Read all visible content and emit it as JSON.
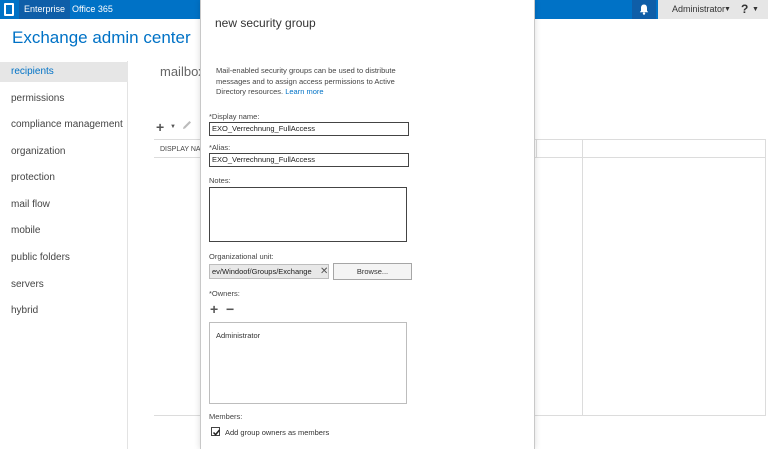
{
  "topbar": {
    "office_icon": "office-logo-icon",
    "tabs": [
      {
        "label": "Enterprise",
        "active": true
      },
      {
        "label": "Office 365",
        "active": false
      }
    ],
    "notification_icon": "bell-icon",
    "user": "Administrator",
    "help": "?",
    "accent": "#0072c6"
  },
  "app_title": "Exchange admin center",
  "leftnav": {
    "items": [
      {
        "label": "recipients",
        "selected": true
      },
      {
        "label": "permissions"
      },
      {
        "label": "compliance management"
      },
      {
        "label": "organization"
      },
      {
        "label": "protection"
      },
      {
        "label": "mail flow"
      },
      {
        "label": "mobile"
      },
      {
        "label": "public folders"
      },
      {
        "label": "servers"
      },
      {
        "label": "hybrid"
      }
    ]
  },
  "main": {
    "title": "mailboxes",
    "toolbar": {
      "add_icon": "plus-icon",
      "edit_icon": "pencil-icon"
    },
    "column_header": "DISPLAY NAME"
  },
  "dialog": {
    "title": "new security group",
    "description": "Mail-enabled security groups can be used to distribute messages and to assign access permissions to Active Directory resources.",
    "learn_more": "Learn more",
    "display_name_label": "*Display name:",
    "display_name_value": "EXO_Verrechnung_FullAccess",
    "alias_label": "*Alias:",
    "alias_value": "EXO_Verrechnung_FullAccess",
    "notes_label": "Notes:",
    "notes_value": "",
    "ou_label": "Organizational unit:",
    "ou_value": "ev/Windoof/Groups/Exchange",
    "browse_label": "Browse...",
    "owners_label": "*Owners:",
    "owners": [
      "Administrator"
    ],
    "members_label": "Members:",
    "add_owners_as_members_label": "Add group owners as members",
    "add_owners_as_members_checked": true
  }
}
